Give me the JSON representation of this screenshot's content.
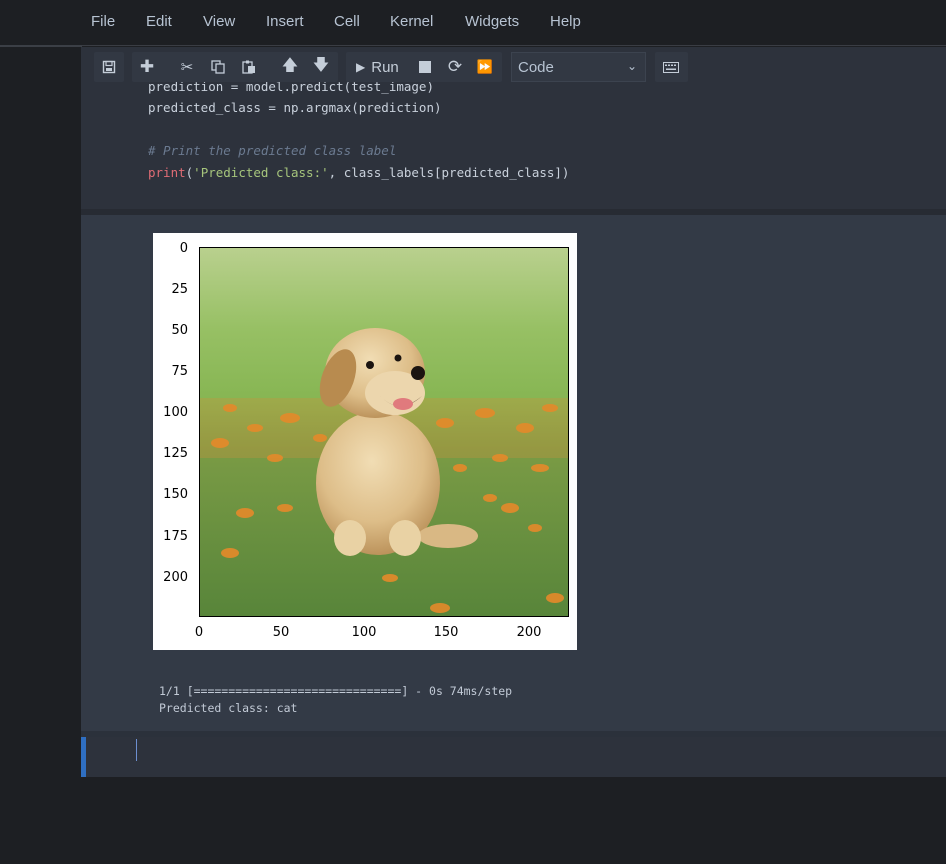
{
  "menubar": {
    "items": [
      "File",
      "Edit",
      "View",
      "Insert",
      "Cell",
      "Kernel",
      "Widgets",
      "Help"
    ]
  },
  "toolbar": {
    "run_label": "Run",
    "cell_type": "Code"
  },
  "code": {
    "line1": "prediction = model.predict(test_image)",
    "line2": "predicted_class = np.argmax(prediction)",
    "comment": "# Print the predicted class label",
    "print_fn": "print",
    "print_open": "(",
    "print_str": "'Predicted class:'",
    "print_rest": ", class_labels[predicted_class])"
  },
  "figure": {
    "y_ticks": [
      "0",
      "25",
      "50",
      "75",
      "100",
      "125",
      "150",
      "175",
      "200"
    ],
    "x_ticks": [
      "0",
      "50",
      "100",
      "150",
      "200"
    ],
    "image_subject": "golden retriever puppy sitting on grass with orange flowers"
  },
  "output": {
    "progress_line": "1/1 [==============================] - 0s 74ms/step",
    "prediction_line": "Predicted class: cat"
  },
  "colors": {
    "accent": "#2f6fc2",
    "background": "#1d1f23",
    "cell_bg": "#333a46"
  }
}
